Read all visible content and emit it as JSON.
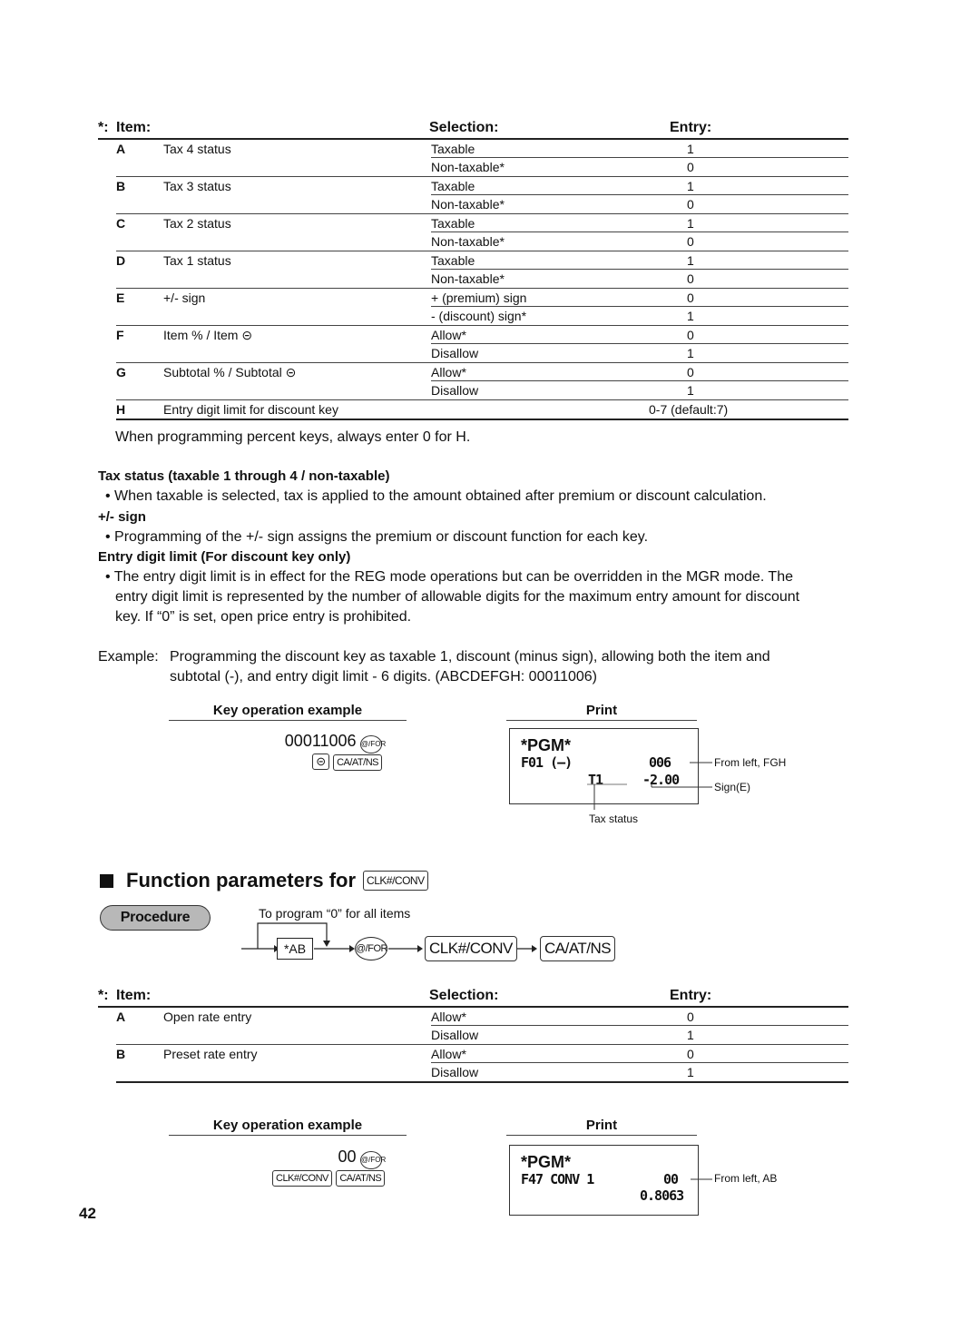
{
  "table1": {
    "header": {
      "marker": "*:",
      "item": "Item:",
      "selection": "Selection:",
      "entry": "Entry:"
    },
    "rows": [
      {
        "code": "A",
        "item": "Tax 4 status",
        "options": [
          {
            "selection": "Taxable",
            "entry": "1"
          },
          {
            "selection": "Non-taxable*",
            "entry": "0"
          }
        ]
      },
      {
        "code": "B",
        "item": "Tax 3 status",
        "options": [
          {
            "selection": "Taxable",
            "entry": "1"
          },
          {
            "selection": "Non-taxable*",
            "entry": "0"
          }
        ]
      },
      {
        "code": "C",
        "item": "Tax 2 status",
        "options": [
          {
            "selection": "Taxable",
            "entry": "1"
          },
          {
            "selection": "Non-taxable*",
            "entry": "0"
          }
        ]
      },
      {
        "code": "D",
        "item": "Tax 1 status",
        "options": [
          {
            "selection": "Taxable",
            "entry": "1"
          },
          {
            "selection": "Non-taxable*",
            "entry": "0"
          }
        ]
      },
      {
        "code": "E",
        "item": "+/- sign",
        "options": [
          {
            "selection": "+ (premium) sign",
            "entry": "0"
          },
          {
            "selection": "- (discount) sign*",
            "entry": "1"
          }
        ]
      },
      {
        "code": "F",
        "item": "Item % / Item ⊝",
        "options": [
          {
            "selection": "Allow*",
            "entry": "0"
          },
          {
            "selection": "Disallow",
            "entry": "1"
          }
        ]
      },
      {
        "code": "G",
        "item": "Subtotal % / Subtotal ⊝",
        "options": [
          {
            "selection": "Allow*",
            "entry": "0"
          },
          {
            "selection": "Disallow",
            "entry": "1"
          }
        ]
      },
      {
        "code": "H",
        "item": "Entry digit limit for discount key",
        "options": [
          {
            "selection": "",
            "entry": "0-7 (default:7)"
          }
        ]
      }
    ],
    "note": "When programming percent keys, always enter 0 for H."
  },
  "notes": {
    "tax_heading": "Tax status (taxable 1 through 4 / non-taxable)",
    "tax_bullet": "• When taxable is selected, tax is applied to the amount obtained after premium or discount calculation.",
    "sign_heading": "+/- sign",
    "sign_bullet": "• Programming of the +/- sign assigns the premium or discount function for each key.",
    "limit_heading": "Entry digit limit (For discount key only)",
    "limit_bullet_1": "• The entry digit limit is in effect for the REG mode operations but can be overridden in the MGR mode.  The",
    "limit_bullet_2": "entry digit limit is represented by the number of allowable digits for the maximum entry amount for discount",
    "limit_bullet_3": "key.  If “0” is set, open price entry is prohibited."
  },
  "example": {
    "label": "Example:",
    "line1": "Programming the discount key as taxable 1, discount (minus sign), allowing both the item and",
    "line2": "subtotal (-), and entry digit limit - 6 digits.  (ABCDEFGH: 00011006)"
  },
  "example1": {
    "key_op_title": "Key operation example",
    "print_title": "Print",
    "entry_value": "00011006",
    "key_for": "@/FOR",
    "key_minus": "⊝",
    "key_ca": "CA/AT/NS",
    "receipt": {
      "line1": "*PGM*",
      "line2_left": "F01 (—)",
      "line2_right": "006",
      "line3_left": "T1",
      "line3_right": "-2.00"
    },
    "annotations": {
      "fgh": "From left, FGH",
      "sign": "Sign(E)",
      "tax": "Tax status"
    }
  },
  "section2": {
    "title": "Function parameters for",
    "title_key": "CLK#/CONV",
    "procedure_label": "Procedure",
    "flow_note": "To program “0” for all items",
    "flow_ab": "*AB",
    "flow_for": "@/FOR",
    "flow_clk": "CLK#/CONV",
    "flow_ca": "CA/AT/NS"
  },
  "table2": {
    "header": {
      "marker": "*:",
      "item": "Item:",
      "selection": "Selection:",
      "entry": "Entry:"
    },
    "rows": [
      {
        "code": "A",
        "item": "Open rate entry",
        "options": [
          {
            "selection": "Allow*",
            "entry": "0"
          },
          {
            "selection": "Disallow",
            "entry": "1"
          }
        ]
      },
      {
        "code": "B",
        "item": "Preset rate entry",
        "options": [
          {
            "selection": "Allow*",
            "entry": "0"
          },
          {
            "selection": "Disallow",
            "entry": "1"
          }
        ]
      }
    ]
  },
  "example2": {
    "key_op_title": "Key operation example",
    "print_title": "Print",
    "entry_value": "00",
    "key_for": "@/FOR",
    "key_clk": "CLK#/CONV",
    "key_ca": "CA/AT/NS",
    "receipt": {
      "line1": "*PGM*",
      "line2_left": "F47 CONV 1",
      "line2_right": "00",
      "line3_right": "0.8063"
    },
    "annotations": {
      "ab": "From left, AB"
    }
  },
  "page_number": "42"
}
